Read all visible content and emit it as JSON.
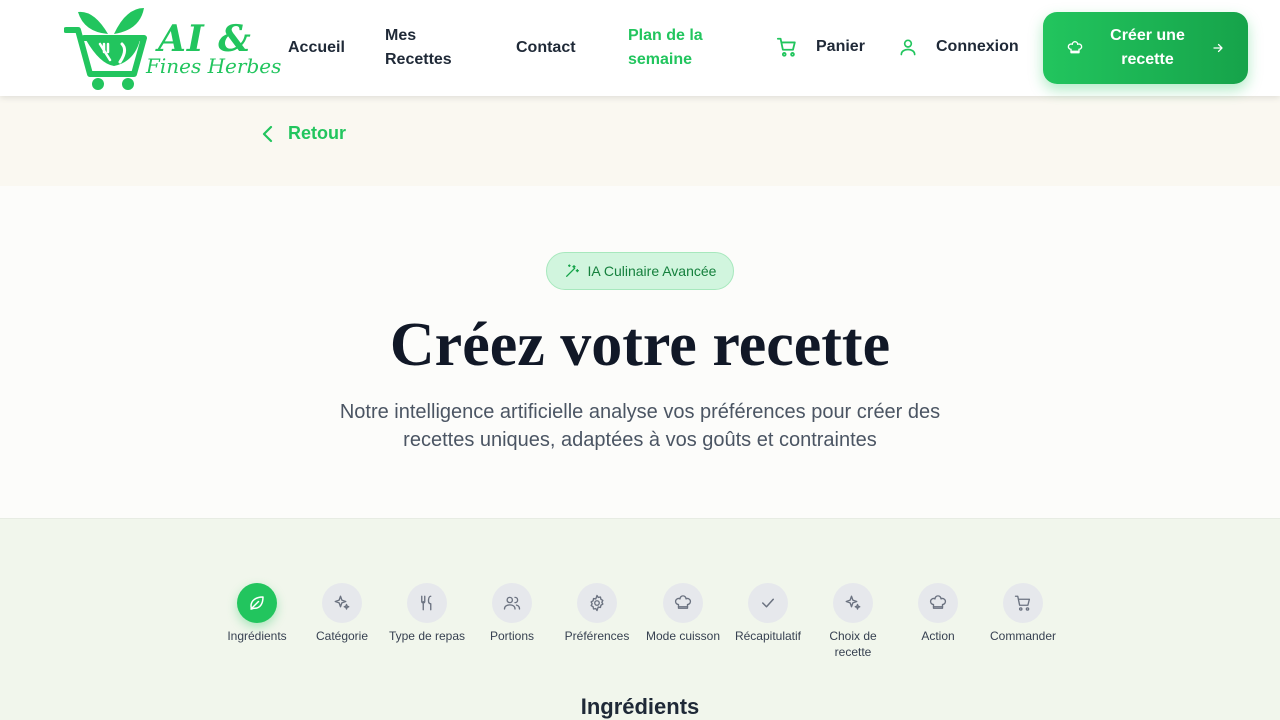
{
  "brand": {
    "line1": "AI &",
    "line2": "Fines Herbes",
    "color": "#22c55e"
  },
  "nav": {
    "accueil": "Accueil",
    "mes_recettes": "Mes Recettes",
    "contact": "Contact",
    "plan": "Plan de la semaine",
    "panier": "Panier",
    "connexion": "Connexion",
    "cta": "Créer une recette"
  },
  "retour": "Retour",
  "hero": {
    "badge": "IA Culinaire Avancée",
    "title": "Créez votre recette",
    "subtitle": "Notre intelligence artificielle analyse vos préférences pour créer des recettes uniques, adaptées à vos goûts et contraintes"
  },
  "steps": [
    {
      "label": "Ingrédients",
      "icon": "leaf-icon",
      "active": true
    },
    {
      "label": "Catégorie",
      "icon": "sparkles-icon",
      "active": false
    },
    {
      "label": "Type de repas",
      "icon": "utensils-icon",
      "active": false
    },
    {
      "label": "Portions",
      "icon": "users-icon",
      "active": false
    },
    {
      "label": "Préférences",
      "icon": "gear-icon",
      "active": false
    },
    {
      "label": "Mode cuisson",
      "icon": "chef-hat-icon",
      "active": false
    },
    {
      "label": "Récapitulatif",
      "icon": "check-icon",
      "active": false
    },
    {
      "label": "Choix de recette",
      "icon": "sparkles-icon",
      "active": false
    },
    {
      "label": "Action",
      "icon": "chef-hat-icon",
      "active": false
    },
    {
      "label": "Commander",
      "icon": "cart-icon",
      "active": false
    }
  ],
  "section_title": "Ingrédients",
  "colors": {
    "accent": "#22c55e",
    "accent_dark": "#16a34a",
    "text": "#111827"
  }
}
